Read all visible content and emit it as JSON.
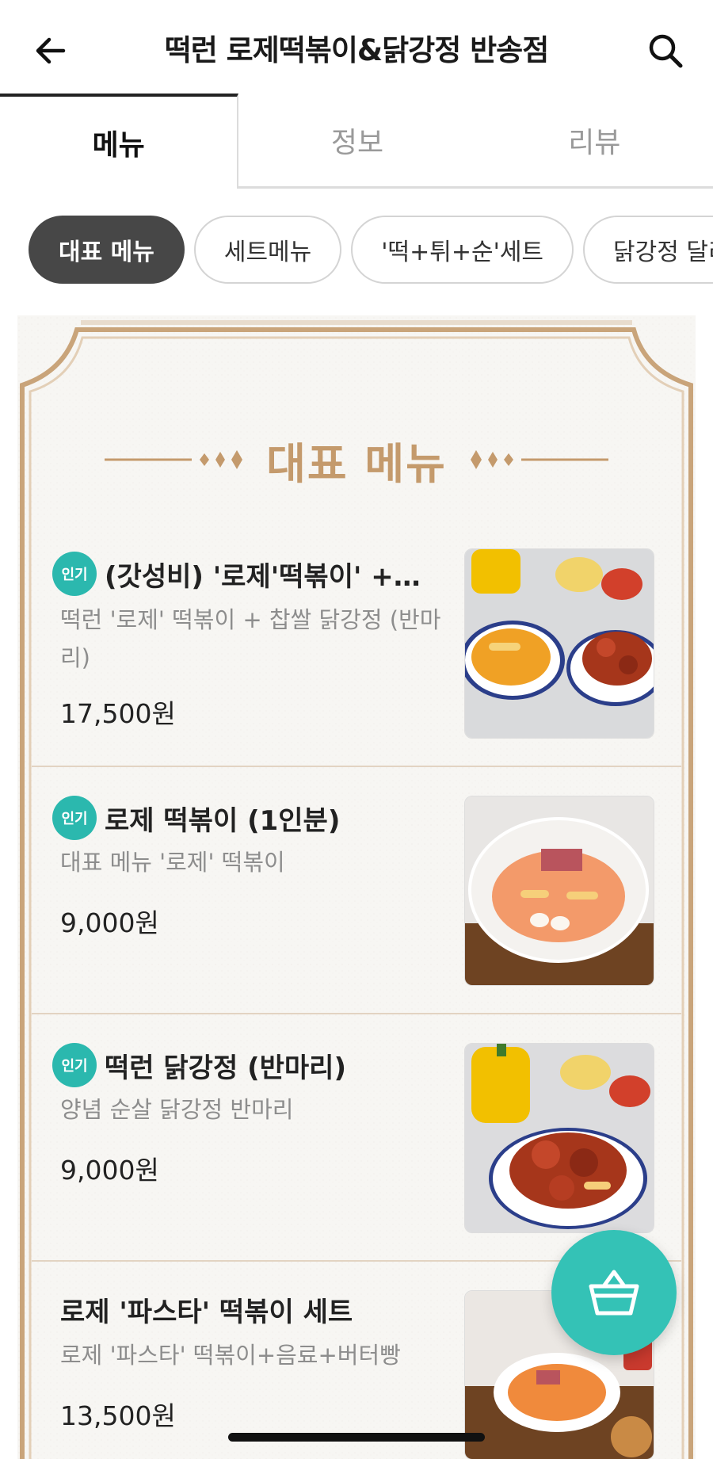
{
  "header": {
    "title": "떡런 로제떡볶이&닭강정 반송점",
    "back_icon": "arrow-left-icon",
    "search_icon": "search-icon"
  },
  "tabs": [
    {
      "label": "메뉴",
      "active": true
    },
    {
      "label": "정보",
      "active": false
    },
    {
      "label": "리뷰",
      "active": false
    }
  ],
  "chips": [
    {
      "label": "대표 메뉴",
      "active": true
    },
    {
      "label": "세트메뉴",
      "active": false
    },
    {
      "label": "'떡+튀+순'세트",
      "active": false
    },
    {
      "label": "닭강정 달리",
      "active": false
    }
  ],
  "section": {
    "title": "대표 메뉴"
  },
  "items": [
    {
      "badge": "인기",
      "name": "(갓성비) '로제'떡볶이' +…",
      "desc_line1": "떡런 '로제' 떡볶이 + 찹쌀 닭강정 (반마",
      "desc_line2": "리)",
      "price": "17,500원"
    },
    {
      "badge": "인기",
      "name": "로제 떡볶이 (1인분)",
      "desc_line1": "대표 메뉴 '로제' 떡볶이",
      "price": "9,000원"
    },
    {
      "badge": "인기",
      "name": "떡런 닭강정 (반마리)",
      "desc_line1": "양념 순살 닭강정 반마리",
      "price": "9,000원"
    },
    {
      "name": "로제 '파스타' 떡볶이 세트",
      "desc_line1": "로제 '파스타' 떡볶이+음료+버터빵",
      "price": "13,500원"
    }
  ],
  "cart": {
    "icon": "shopping-basket-icon"
  },
  "colors": {
    "accent": "#34c2b6",
    "badge": "#2bb8ae",
    "section_title": "#c49a6c",
    "frame": "#c9a47a",
    "chip_active": "#474747"
  }
}
